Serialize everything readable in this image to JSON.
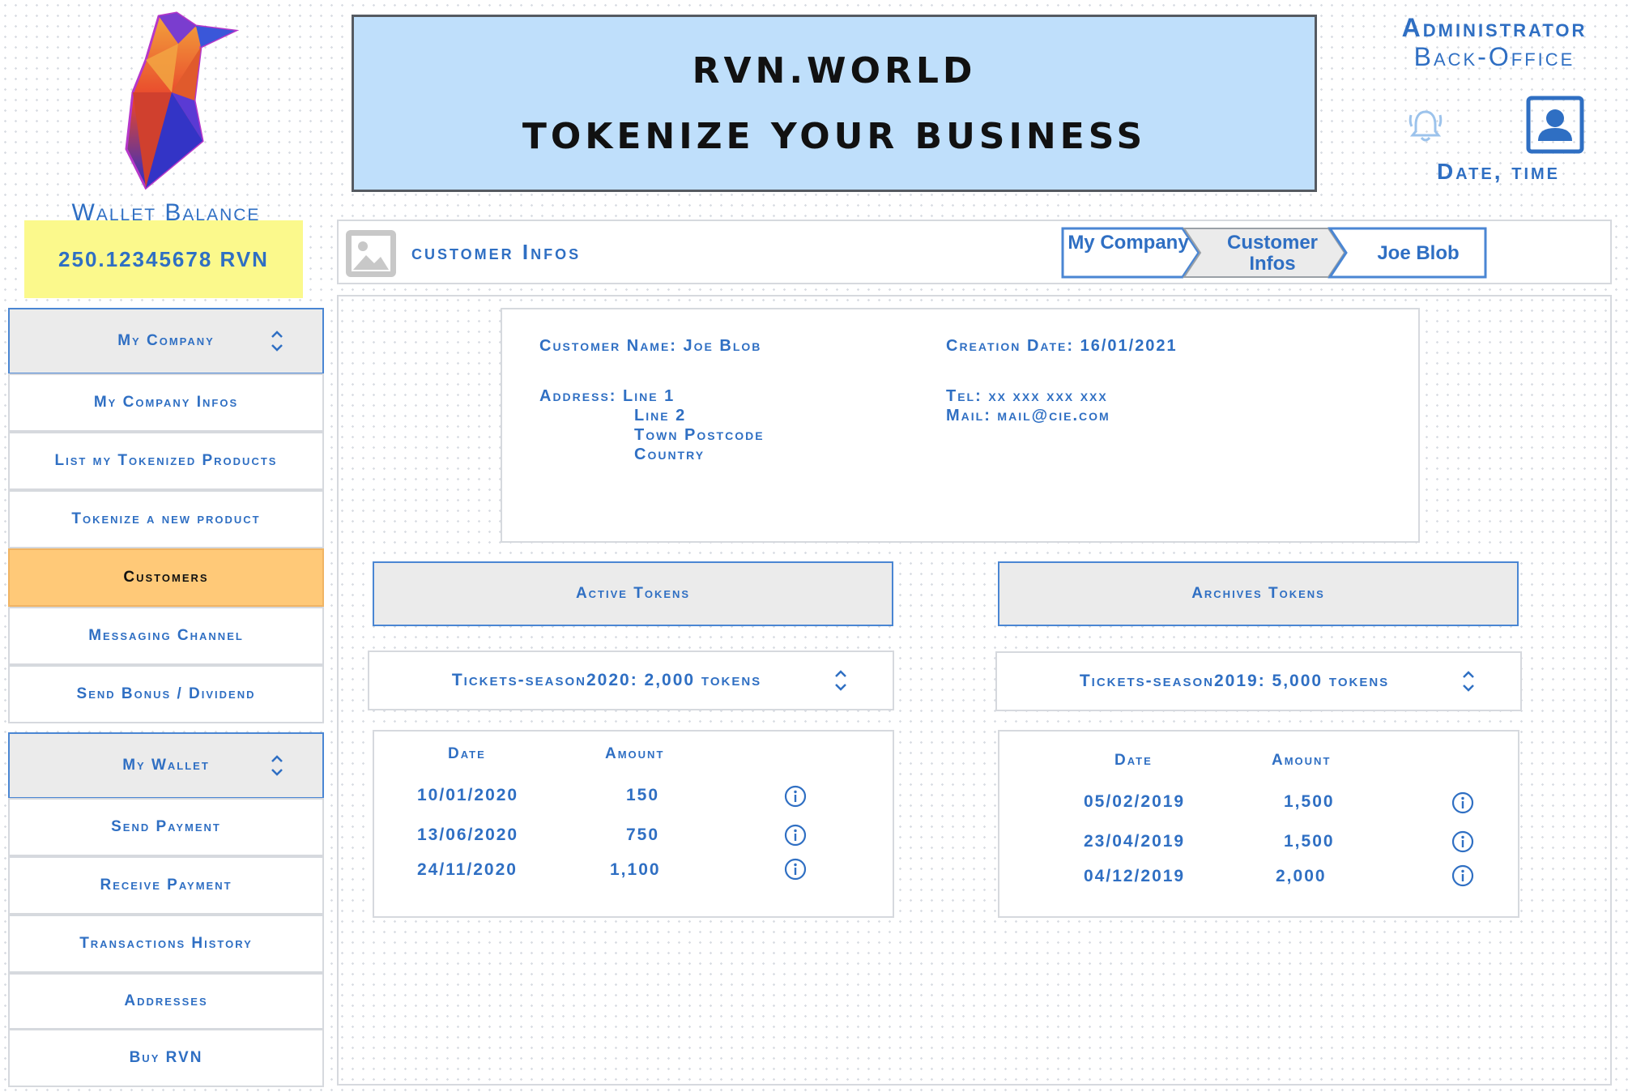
{
  "header": {
    "line1": "RVN.WORLD",
    "line2": "TOKENIZE YOUR BUSINESS",
    "role": "Administrator",
    "area": "Back-Office",
    "datetime": "Date, time"
  },
  "wallet": {
    "label": "Wallet Balance",
    "balance": "250.12345678 RVN"
  },
  "sidebar": {
    "company_head": "My Company",
    "company_items": [
      {
        "label": "My Company Infos"
      },
      {
        "label": "List my Tokenized Products"
      },
      {
        "label": "Tokenize a new product"
      },
      {
        "label": "Customers"
      },
      {
        "label": "Messaging Channel"
      },
      {
        "label": "Send Bonus / Dividend"
      }
    ],
    "wallet_head": "My Wallet",
    "wallet_items": [
      {
        "label": "Send Payment"
      },
      {
        "label": "Receive Payment"
      },
      {
        "label": "Transactions History"
      },
      {
        "label": "Addresses"
      },
      {
        "label": "Buy RVN"
      }
    ]
  },
  "page": {
    "title": "customer Infos",
    "breadcrumb": [
      "My Company",
      "Customer Infos",
      "Joe Blob"
    ]
  },
  "customer": {
    "name": "Customer Name: Joe Blob",
    "creation": "Creation Date: 16/01/2021",
    "address_label": "Address: Line 1",
    "address_lines": [
      "Line 2",
      "Town Postcode",
      "Country"
    ],
    "tel": "Tel: xx xxx xxx xxx",
    "mail": "Mail: mail@cie.com"
  },
  "active": {
    "button": "Active Tokens",
    "selected": "Tickets-season2020: 2,000 tokens",
    "col_date": "Date",
    "col_amount": "Amount",
    "rows": [
      {
        "date": "10/01/2020",
        "amount": "150"
      },
      {
        "date": "13/06/2020",
        "amount": "750"
      },
      {
        "date": "24/11/2020",
        "amount": "1,100"
      }
    ]
  },
  "archives": {
    "button": "Archives Tokens",
    "selected": "Tickets-season2019: 5,000 tokens",
    "col_date": "Date",
    "col_amount": "Amount",
    "rows": [
      {
        "date": "05/02/2019",
        "amount": "1,500"
      },
      {
        "date": "23/04/2019",
        "amount": "1,500"
      },
      {
        "date": "04/12/2019",
        "amount": "2,000"
      }
    ]
  },
  "colors": {
    "accent": "#2f6fc3",
    "banner": "#bfdffb",
    "balance_bg": "#fbf98c",
    "active_item": "#ffc978"
  }
}
